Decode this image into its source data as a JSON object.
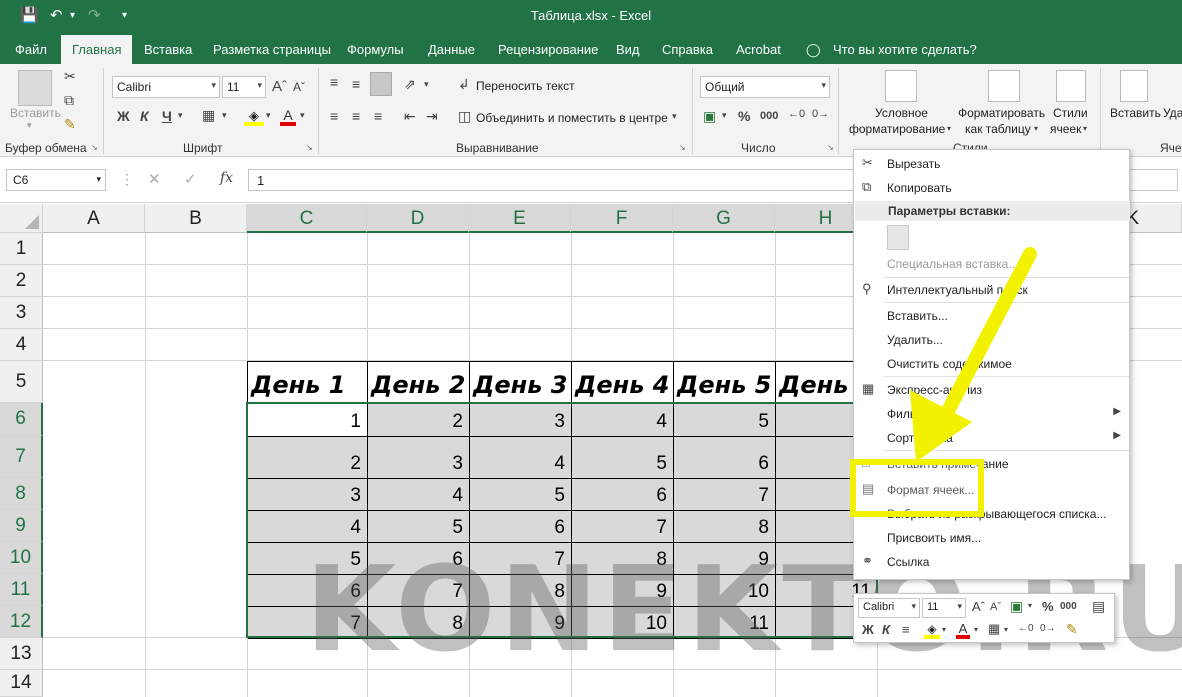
{
  "window": {
    "title": "Таблица.xlsx  -  Excel"
  },
  "tabs": [
    "Файл",
    "Главная",
    "Вставка",
    "Разметка страницы",
    "Формулы",
    "Данные",
    "Рецензирование",
    "Вид",
    "Справка",
    "Acrobat"
  ],
  "tell_me": "Что вы хотите сделать?",
  "ribbon": {
    "paste_label": "Вставить",
    "clipboard_label": "Буфер обмена",
    "font_name": "Calibri",
    "font_size": "11",
    "bold": "Ж",
    "italic": "К",
    "underline": "Ч",
    "font_label": "Шрифт",
    "wrap_text": "Переносить текст",
    "merge_center": "Объединить и поместить в центре",
    "align_label": "Выравнивание",
    "number_format": "Общий",
    "number_label": "Число",
    "cond_format_1": "Условное",
    "cond_format_2": "форматирование",
    "format_table_1": "Форматировать",
    "format_table_2": "как таблицу",
    "cell_styles_1": "Стили",
    "cell_styles_2": "ячеек",
    "styles_label": "Стили",
    "insert_label": "Вставить",
    "insert_cut": "Уда",
    "cells_label": "Яче"
  },
  "formula_bar": {
    "name_box": "C6",
    "value": "1",
    "fx": "fx"
  },
  "columns": [
    "A",
    "B",
    "C",
    "D",
    "E",
    "F",
    "G",
    "H",
    "K"
  ],
  "rows": [
    "1",
    "2",
    "3",
    "4",
    "5",
    "6",
    "7",
    "8",
    "9",
    "10",
    "11",
    "12",
    "13",
    "14"
  ],
  "table": {
    "headers": [
      "День 1",
      "День 2",
      "День 3",
      "День 4",
      "День 5",
      "День"
    ],
    "data": [
      [
        "1",
        "2",
        "3",
        "4",
        "5",
        ""
      ],
      [
        "2",
        "3",
        "4",
        "5",
        "6",
        ""
      ],
      [
        "3",
        "4",
        "5",
        "6",
        "7",
        ""
      ],
      [
        "4",
        "5",
        "6",
        "7",
        "8",
        ""
      ],
      [
        "5",
        "6",
        "7",
        "8",
        "9",
        "1"
      ],
      [
        "6",
        "7",
        "8",
        "9",
        "10",
        "11"
      ],
      [
        "7",
        "8",
        "9",
        "10",
        "11",
        "1"
      ]
    ]
  },
  "context_menu": {
    "cut": "Вырезать",
    "copy": "Копировать",
    "paste_options": "Параметры вставки:",
    "paste_special": "Специальная вставка...",
    "smart_lookup": "Интеллектуальный поиск",
    "insert": "Вставить...",
    "delete": "Удалить...",
    "clear": "Очистить содержимое",
    "quick_analysis": "Экспресс-анализ",
    "filter": "Фильтр",
    "sort": "Сортировка",
    "comment": "Вставить примечание",
    "format_cells": "Формат ячеек...",
    "pick_list": "Выбрать из раскрывающегося списка...",
    "define_name": "Присвоить имя...",
    "link": "Ссылка"
  },
  "mini_toolbar": {
    "font": "Calibri",
    "size": "11"
  },
  "watermark": "KONEKTO.RU",
  "colors": {
    "excel_green": "#217346",
    "highlight": "#ffff00",
    "selection_gray": "#d9d9d9"
  }
}
